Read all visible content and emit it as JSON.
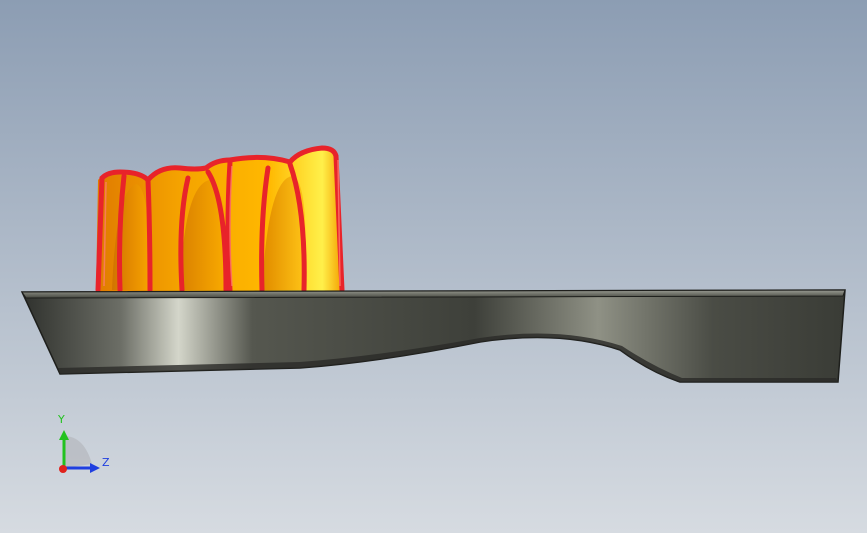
{
  "viewport": {
    "background_top": "#8c9db3",
    "background_bottom": "#d6dbe1"
  },
  "model": {
    "base_color_dark": "#3b3d38",
    "base_color_light": "#c9ccbf",
    "bristle_color_light": "#ffd21a",
    "bristle_color_dark": "#e07b00",
    "bristle_edge_color": "#e8232a"
  },
  "triad": {
    "y_label": "Y",
    "z_label": "Z",
    "y_color": "#22c21f",
    "z_color": "#1f3fe0",
    "x_color": "#e0221c"
  }
}
